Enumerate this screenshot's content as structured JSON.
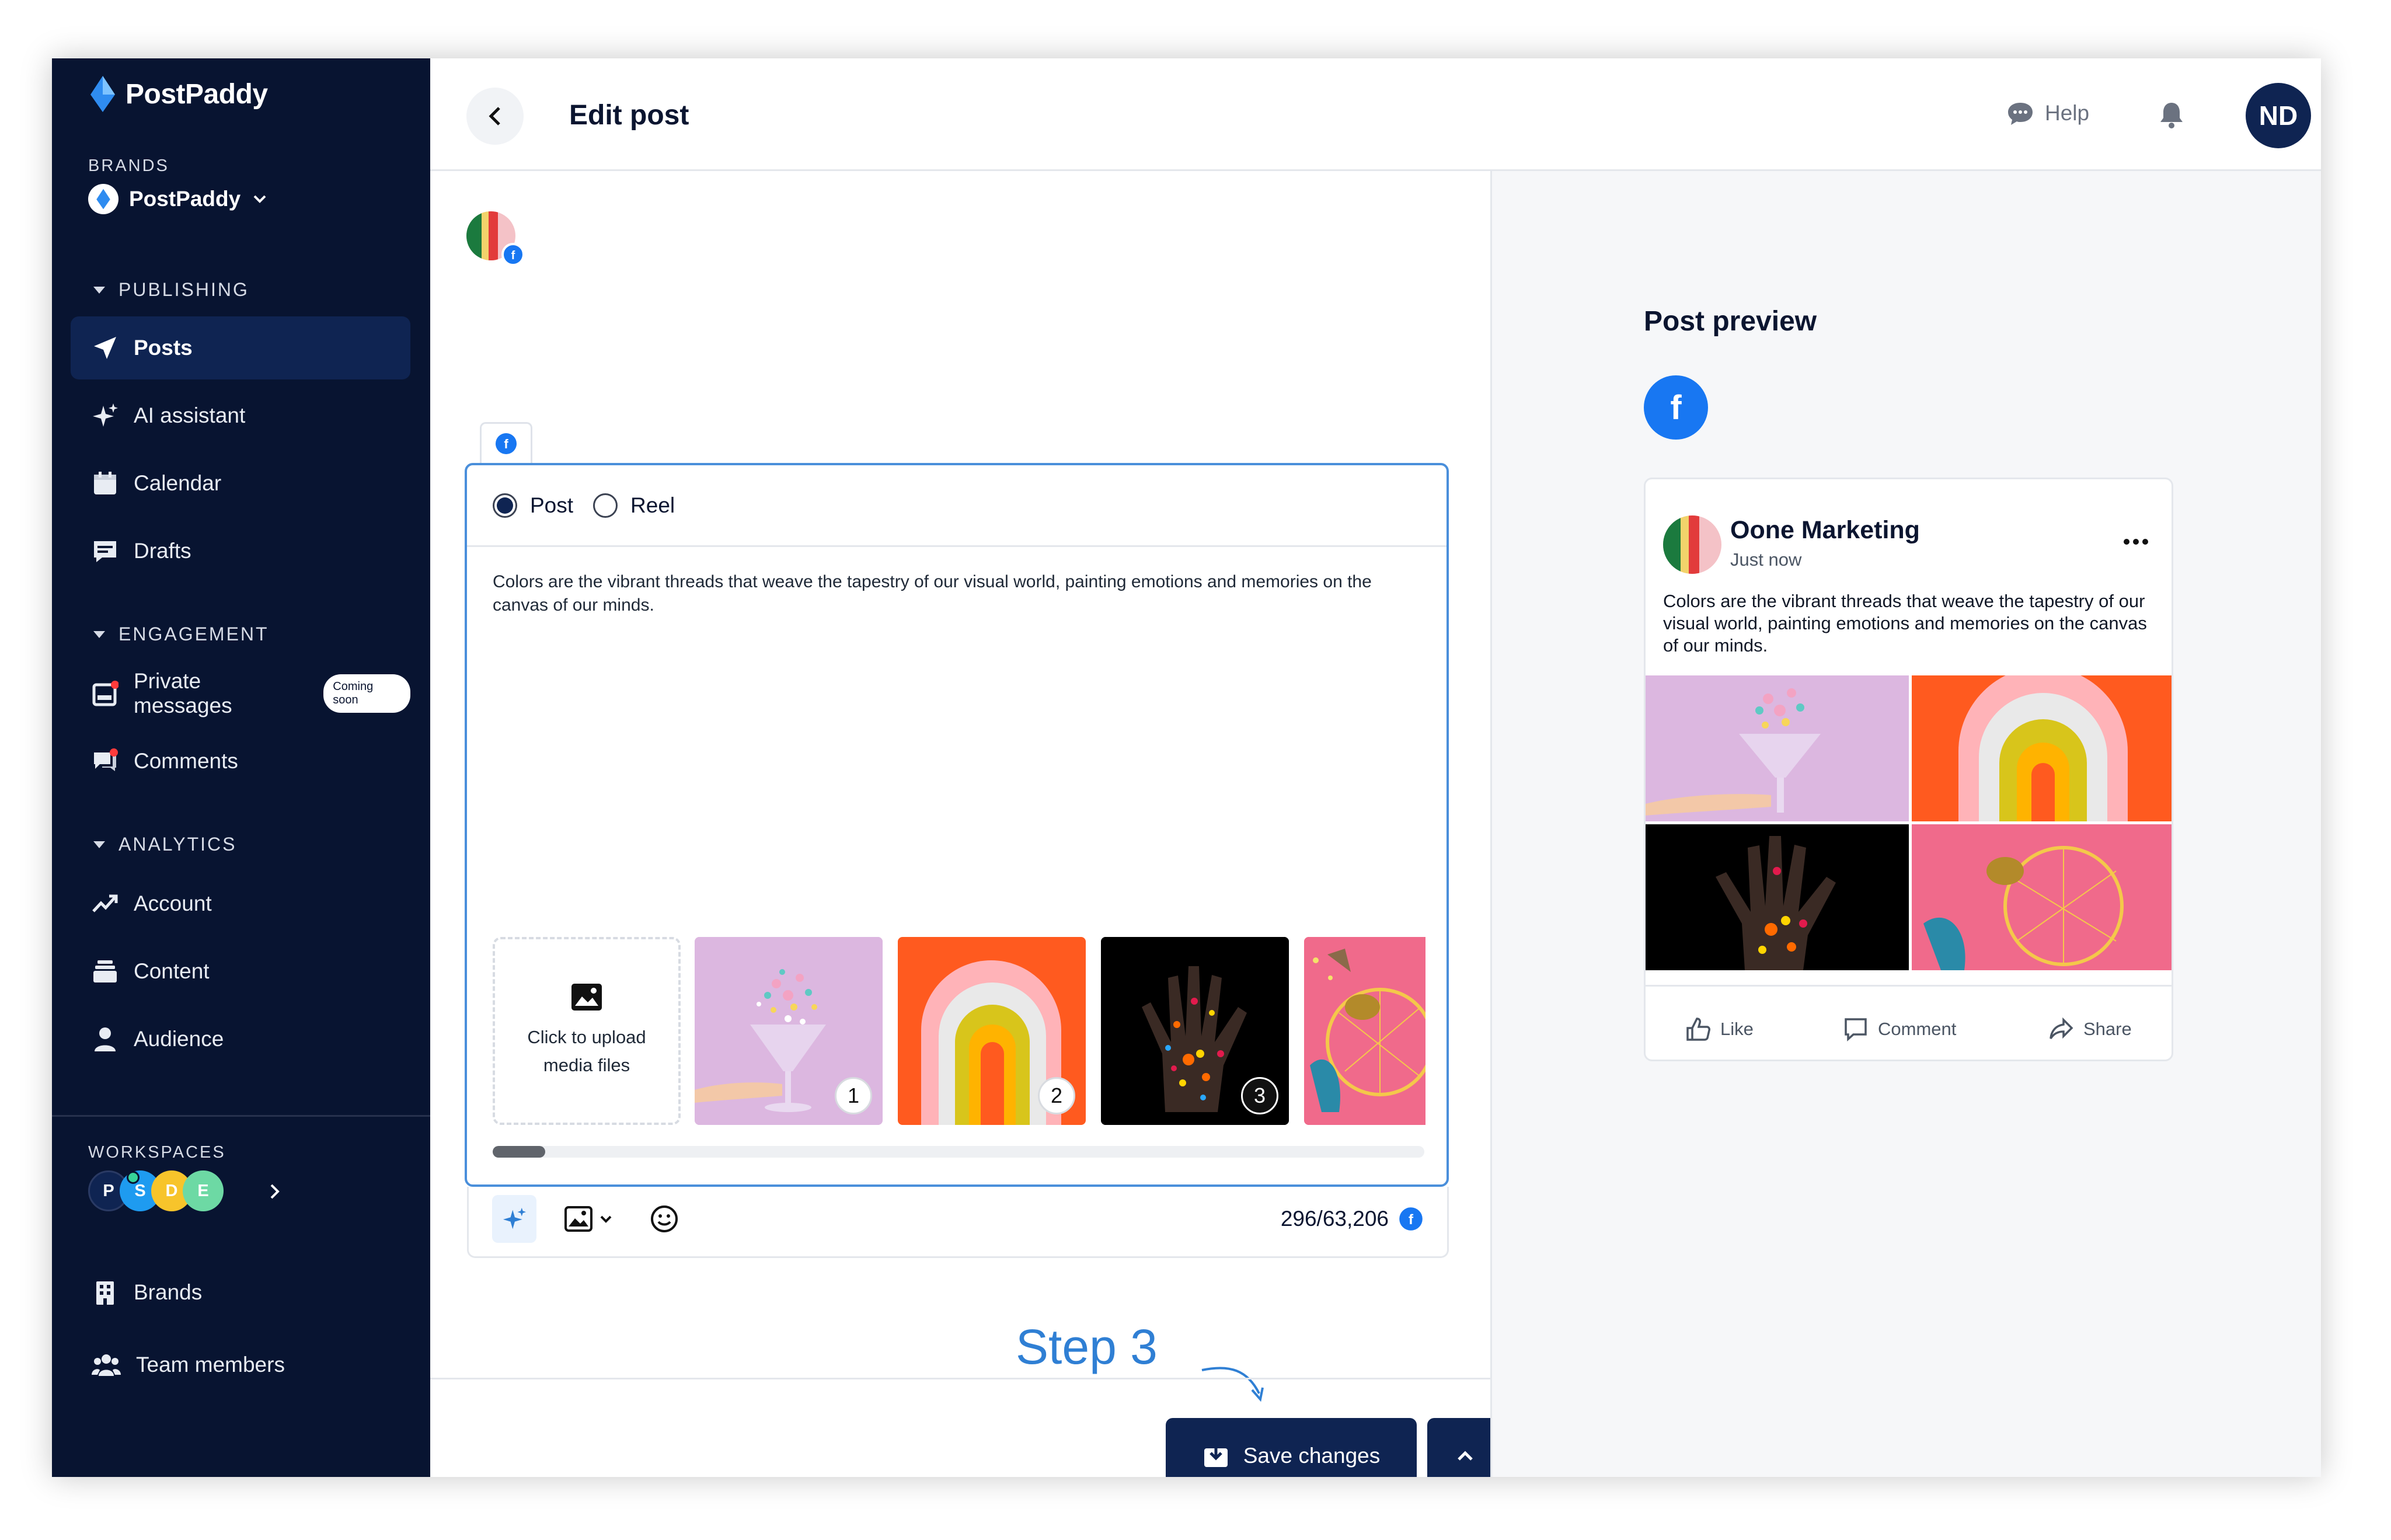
{
  "app": {
    "name": "PostPaddy"
  },
  "sidebar": {
    "brands_label": "BRANDS",
    "brand_name": "PostPaddy",
    "groups": {
      "publishing": "PUBLISHING",
      "engagement": "ENGAGEMENT",
      "analytics": "ANALYTICS"
    },
    "items": [
      {
        "label": "Posts",
        "icon": "send-icon",
        "active": true
      },
      {
        "label": "AI assistant",
        "icon": "sparkle-icon"
      },
      {
        "label": "Calendar",
        "icon": "calendar-icon"
      },
      {
        "label": "Drafts",
        "icon": "drafts-icon"
      },
      {
        "label": "Private messages",
        "icon": "inbox-icon",
        "badge": "Coming soon"
      },
      {
        "label": "Comments",
        "icon": "comments-icon"
      },
      {
        "label": "Account",
        "icon": "trend-icon"
      },
      {
        "label": "Content",
        "icon": "stack-icon"
      },
      {
        "label": "Audience",
        "icon": "person-icon"
      },
      {
        "label": "Brands",
        "icon": "building-icon"
      },
      {
        "label": "Team members",
        "icon": "team-icon"
      }
    ],
    "workspaces_label": "WORKSPACES",
    "workspaces": [
      {
        "letter": "P",
        "color": "#0f2452"
      },
      {
        "letter": "S",
        "color": "#1e9bf0"
      },
      {
        "letter": "D",
        "color": "#f7c42b"
      },
      {
        "letter": "E",
        "color": "#6dd9a4"
      }
    ]
  },
  "header": {
    "title": "Edit post",
    "help": "Help",
    "avatar_initials": "ND"
  },
  "editor": {
    "post_type_options": [
      "Post",
      "Reel"
    ],
    "selected_type": "Post",
    "body": "Colors are the vibrant threads that weave the tapestry of our visual world, painting emotions and memories on the canvas of our minds.",
    "upload_label": "Click to upload media files",
    "media_numbers": [
      "1",
      "2",
      "3"
    ],
    "char_count": "296/63,206",
    "step_label": "Step 3",
    "save_label": "Save changes"
  },
  "preview": {
    "title": "Post preview",
    "page_name": "Oone Marketing",
    "time": "Just now",
    "text": "Colors are the vibrant threads that weave the tapestry of our visual world, painting emotions and memories on the canvas of our minds.",
    "actions": {
      "like": "Like",
      "comment": "Comment",
      "share": "Share"
    }
  },
  "colors": {
    "sidebar": "#081431",
    "accent": "#0f2452",
    "facebook": "#1877f2",
    "step": "#2f7fd4"
  }
}
